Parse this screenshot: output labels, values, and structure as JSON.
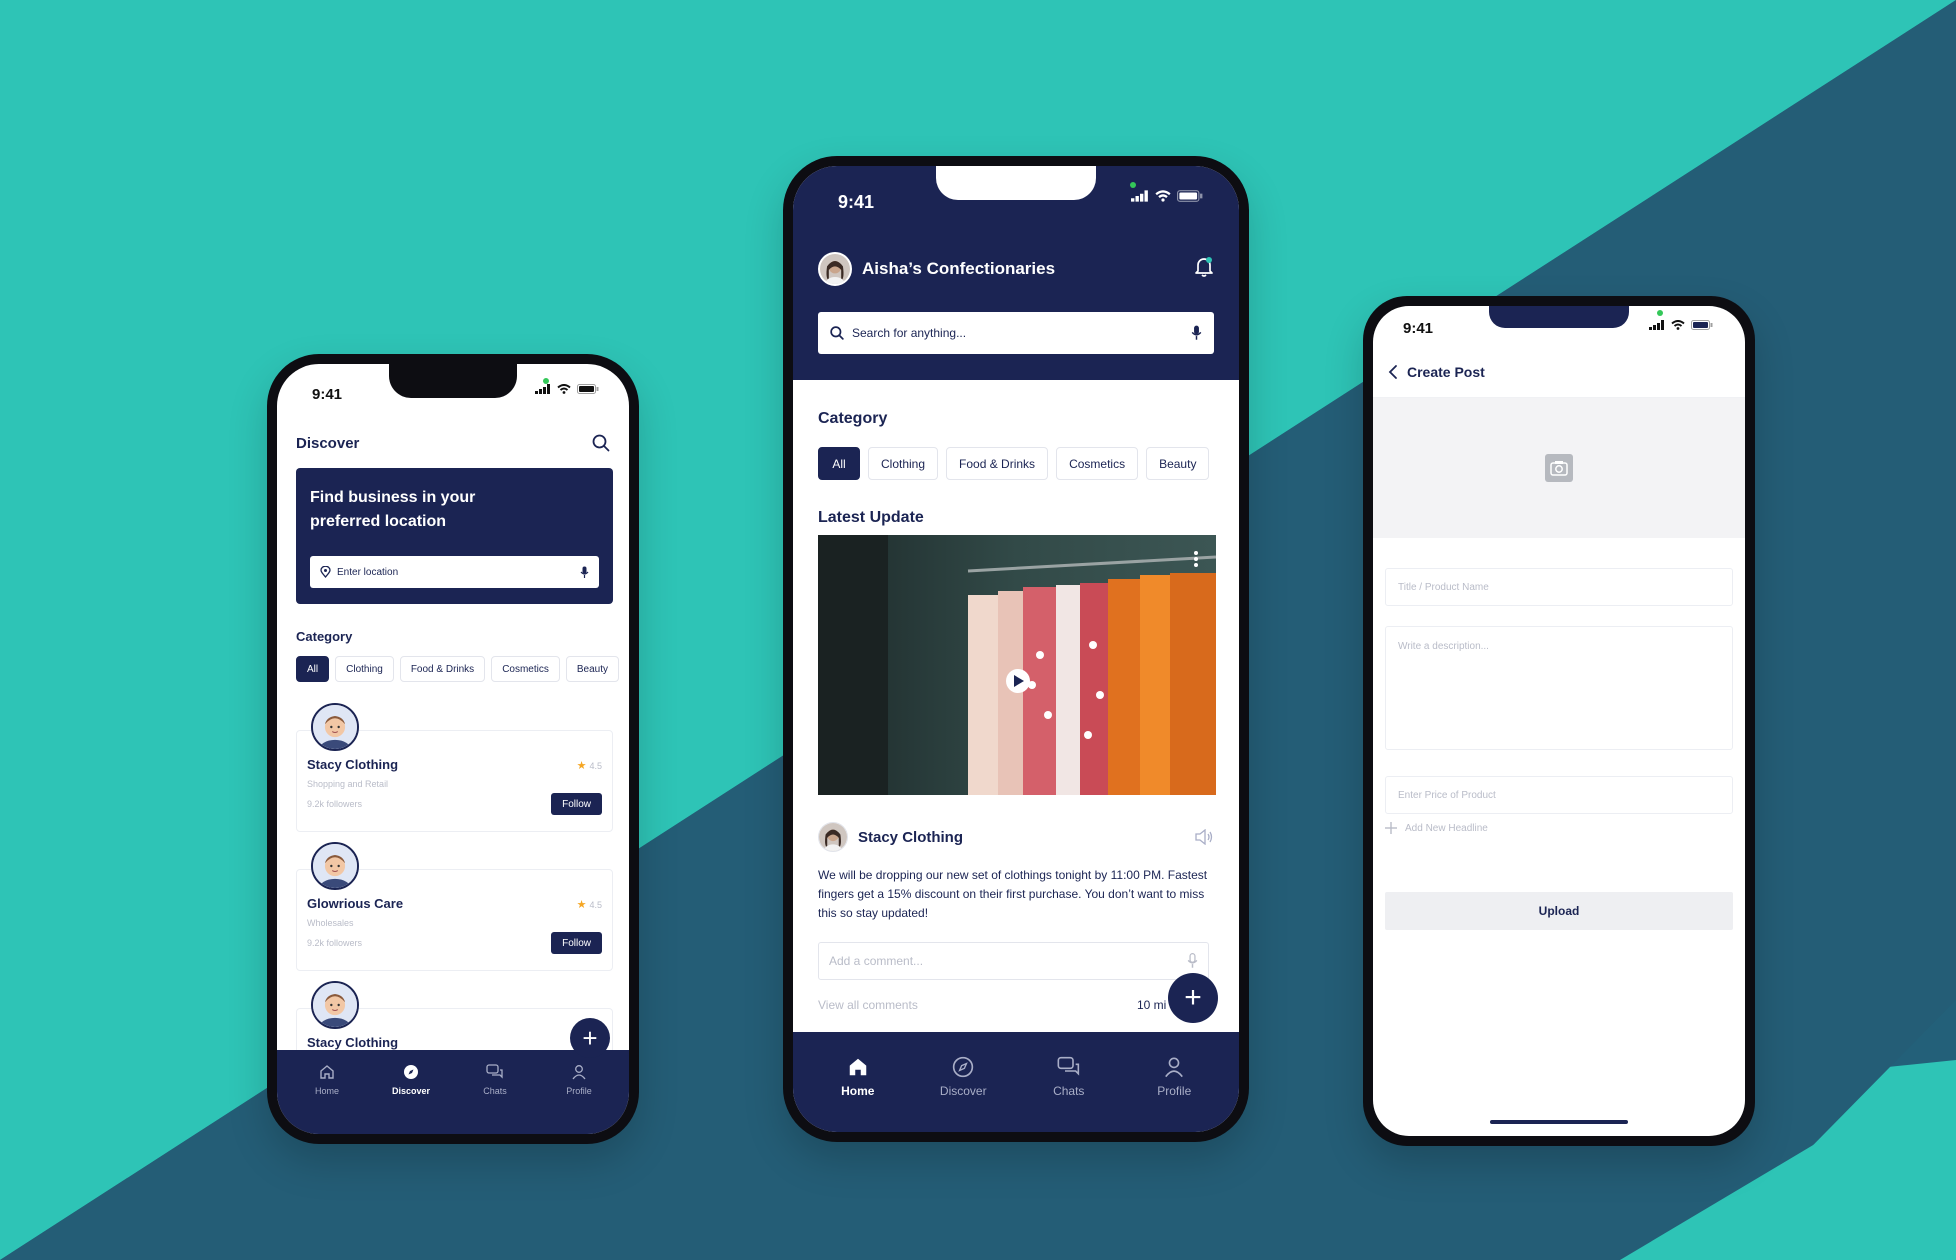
{
  "colors": {
    "background_teal": "#2ec4b6",
    "background_dark_teal": "#215a72",
    "navy": "#1b2453",
    "accent_star": "#f5a623"
  },
  "phone1": {
    "status_time": "9:41",
    "header": {
      "title": "Discover",
      "search_icon": "search-icon"
    },
    "hero": {
      "text": "Find business in your preferred location",
      "location_placeholder": "Enter location"
    },
    "category_label": "Category",
    "categories": [
      "All",
      "Clothing",
      "Food & Drinks",
      "Cosmetics",
      "Beauty"
    ],
    "selected_category": "All",
    "businesses": [
      {
        "name": "Stacy Clothing",
        "type": "Shopping and Retail",
        "followers": "9.2k followers",
        "rating": "4.5",
        "follow_label": "Follow"
      },
      {
        "name": "Glowrious Care",
        "type": "Wholesales",
        "followers": "9.2k followers",
        "rating": "4.5",
        "follow_label": "Follow"
      },
      {
        "name": "Stacy Clothing"
      }
    ],
    "fab_label": "+",
    "tabs": [
      "Home",
      "Discover",
      "Chats",
      "Profile"
    ],
    "active_tab": "Discover"
  },
  "phone2": {
    "status_time": "9:41",
    "brand_name": "Aisha’s Confectionaries",
    "search_placeholder": "Search for anything...",
    "category_label": "Category",
    "categories": [
      "All",
      "Clothing",
      "Food & Drinks",
      "Cosmetics",
      "Beauty"
    ],
    "selected_category": "All",
    "latest_label": "Latest Update",
    "post": {
      "author": "Stacy Clothing",
      "text": "We will be dropping our new set of clothings tonight by 11:00 PM. Fastest fingers get a 15% discount on their first purchase. You don’t want to miss this so stay updated!",
      "comment_placeholder": "Add a comment...",
      "view_all": "View all comments",
      "time": "10 mi"
    },
    "fab_label": "+",
    "tabs": [
      "Home",
      "Discover",
      "Chats",
      "Profile"
    ],
    "active_tab": "Home"
  },
  "phone3": {
    "status_time": "9:41",
    "title": "Create Post",
    "fields": {
      "title_placeholder": "Title / Product Name",
      "description_placeholder": "Write a description...",
      "price_placeholder": "Enter Price of Product"
    },
    "add_headline": "Add New Headline",
    "upload_label": "Upload"
  }
}
